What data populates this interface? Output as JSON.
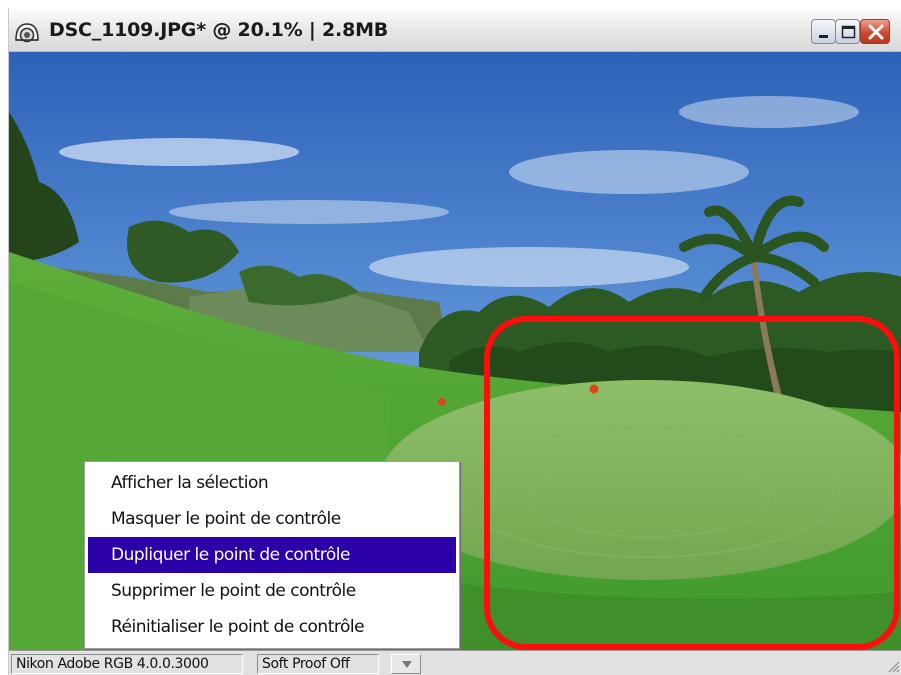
{
  "window": {
    "title": "DSC_1109.JPG* @ 20.1% | 2.8MB",
    "app_icon": "aperture-icon",
    "controls": [
      "minimize-icon",
      "maximize-icon",
      "close-icon"
    ]
  },
  "canvas": {
    "image": "golf-course-photo"
  },
  "context_menu": {
    "items": [
      {
        "label": "Afficher la sélection",
        "highlighted": false
      },
      {
        "label": "Masquer le point de contrôle",
        "highlighted": false
      },
      {
        "label": "Dupliquer le point de contrôle",
        "highlighted": true
      },
      {
        "label": "Supprimer le point de contrôle",
        "highlighted": false
      },
      {
        "label": "Réinitialiser le point de contrôle",
        "highlighted": false
      }
    ]
  },
  "status_bar": {
    "color_profile": "Nikon Adobe RGB 4.0.0.3000",
    "soft_proof": "Soft Proof Off",
    "dropdown_icon": "chevron-down-icon"
  },
  "colors": {
    "menu_highlight": "#2b00a8",
    "annotation": "#ff0d0d"
  }
}
